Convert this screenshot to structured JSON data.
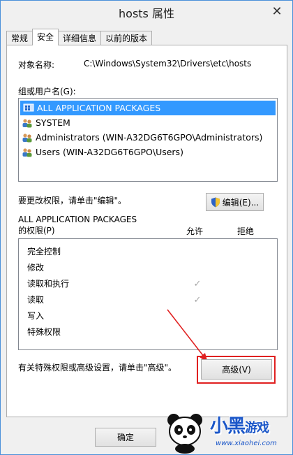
{
  "window": {
    "title": "hosts 属性",
    "close_glyph": "✕"
  },
  "tabs": [
    {
      "label": "常规",
      "active": false
    },
    {
      "label": "安全",
      "active": true
    },
    {
      "label": "详细信息",
      "active": false
    },
    {
      "label": "以前的版本",
      "active": false
    }
  ],
  "object": {
    "label": "对象名称:",
    "value": "C:\\Windows\\System32\\Drivers\\etc\\hosts"
  },
  "groups": {
    "label": "组或用户名(G):",
    "items": [
      {
        "name": "ALL APPLICATION PACKAGES",
        "selected": true,
        "icon": "app-packages-icon"
      },
      {
        "name": "SYSTEM",
        "selected": false,
        "icon": "users-icon"
      },
      {
        "name": "Administrators (WIN-A32DG6T6GPO\\Administrators)",
        "selected": false,
        "icon": "users-icon"
      },
      {
        "name": "Users (WIN-A32DG6T6GPO\\Users)",
        "selected": false,
        "icon": "users-icon"
      }
    ]
  },
  "edit": {
    "hint": "要更改权限，请单击\"编辑\"。",
    "button_label": "编辑(E)...",
    "icon": "shield-icon"
  },
  "permissions": {
    "title_line1": "ALL APPLICATION PACKAGES",
    "title_line2": "的权限(P)",
    "col_allow": "允许",
    "col_deny": "拒绝",
    "rows": [
      {
        "name": "完全控制",
        "allow": false,
        "deny": false
      },
      {
        "name": "修改",
        "allow": false,
        "deny": false
      },
      {
        "name": "读取和执行",
        "allow": true,
        "deny": false
      },
      {
        "name": "读取",
        "allow": true,
        "deny": false
      },
      {
        "name": "写入",
        "allow": false,
        "deny": false
      },
      {
        "name": "特殊权限",
        "allow": false,
        "deny": false
      }
    ],
    "check_glyph": "✓"
  },
  "advanced": {
    "hint": "有关特殊权限或高级设置，请单击\"高级\"。",
    "button_label": "高级(V)",
    "highlight_color": "#e02020"
  },
  "footer": {
    "ok_label": "确定"
  },
  "watermark": {
    "brand_big": "小黑",
    "brand_small": "游戏",
    "url": "www.xiaohei.com"
  }
}
